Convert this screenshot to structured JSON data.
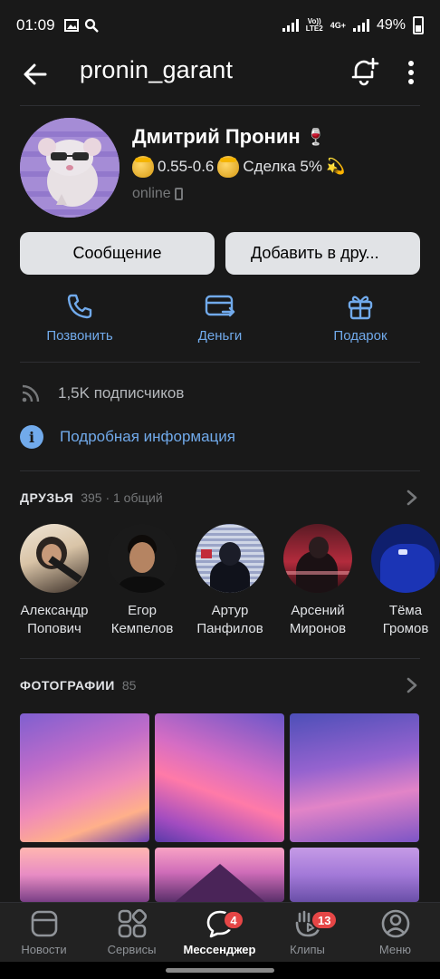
{
  "status_bar": {
    "time": "01:09",
    "network_top": "Vo))",
    "network_bottom": "LTE2",
    "network_type": "4G+",
    "battery": "49%"
  },
  "header": {
    "title": "pronin_garant",
    "icons": [
      "back-arrow-icon",
      "bell-plus-icon",
      "more-vertical-icon"
    ]
  },
  "profile": {
    "name": "Дмитрий Пронин",
    "name_emoji": "🍷",
    "status_rate": "0.55-0.6",
    "status_deal": "Сделка 5%",
    "status_emoji": "💫",
    "online": "online"
  },
  "buttons": {
    "message": "Сообщение",
    "add_friend": "Добавить в дру..."
  },
  "actions": [
    {
      "label": "Позвонить",
      "icon": "phone-icon"
    },
    {
      "label": "Деньги",
      "icon": "money-transfer-icon"
    },
    {
      "label": "Подарок",
      "icon": "gift-icon"
    }
  ],
  "info": {
    "followers": "1,5K подписчиков",
    "details": "Подробная информация"
  },
  "friends": {
    "title": "ДРУЗЬЯ",
    "count": "395 · 1 общий",
    "items": [
      {
        "first": "Александр",
        "last": "Попович"
      },
      {
        "first": "Егор",
        "last": "Кемпелов"
      },
      {
        "first": "Артур",
        "last": "Панфилов"
      },
      {
        "first": "Арсений",
        "last": "Миронов"
      },
      {
        "first": "Тёма",
        "last": "Громов"
      }
    ]
  },
  "photos": {
    "title": "ФОТОГРАФИИ",
    "count": "85"
  },
  "tabbar": {
    "items": [
      {
        "label": "Новости",
        "icon": "news-icon"
      },
      {
        "label": "Сервисы",
        "icon": "services-icon"
      },
      {
        "label": "Мессенджер",
        "icon": "messenger-icon",
        "badge": "4"
      },
      {
        "label": "Клипы",
        "icon": "clips-icon",
        "badge": "13"
      },
      {
        "label": "Меню",
        "icon": "profile-menu-icon"
      }
    ]
  },
  "colors": {
    "background": "#191919",
    "accent": "#71aaeb",
    "button_bg": "#e1e3e6",
    "badge": "#e64646"
  }
}
